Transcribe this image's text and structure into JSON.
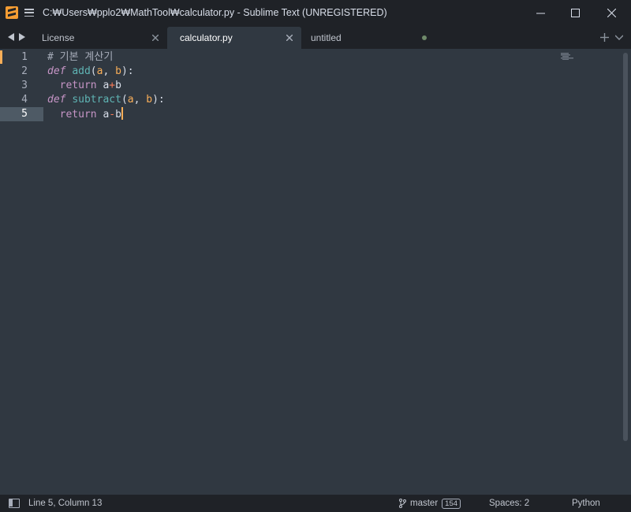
{
  "window": {
    "title": "C:₩Users₩pplo2₩MathTool₩calculator.py - Sublime Text (UNREGISTERED)",
    "app_icon": "sublime-logo-icon",
    "menu_icon": "hamburger-menu-icon",
    "controls": [
      "minimize-icon",
      "maximize-icon",
      "close-icon"
    ]
  },
  "tabs": [
    {
      "label": "License",
      "active": false,
      "dirty": false
    },
    {
      "label": "calculator.py",
      "active": true,
      "dirty": false
    },
    {
      "label": "untitled",
      "active": false,
      "dirty": true
    }
  ],
  "editor": {
    "line_numbers": [
      "1",
      "2",
      "3",
      "4",
      "5"
    ],
    "active_line": 5,
    "lines": [
      {
        "comment": "# 기본 계산기"
      },
      {
        "keyword": "def",
        "name": "add",
        "open": "(",
        "p1": "a",
        "sep": ", ",
        "p2": "b",
        "close": "):"
      },
      {
        "indent": "  ",
        "keyword": "return",
        "left": "a",
        "op": "+",
        "right": "b"
      },
      {
        "keyword": "def",
        "name": "subtract",
        "open": "(",
        "p1": "a",
        "sep": ", ",
        "p2": "b",
        "close": "):"
      },
      {
        "indent": "  ",
        "keyword": "return",
        "left": "a",
        "op": "-",
        "right": "b"
      }
    ]
  },
  "status": {
    "cursor_position": "Line 5, Column 13",
    "branch": "master",
    "branch_count": "154",
    "indentation": "Spaces: 2",
    "syntax": "Python"
  },
  "colors": {
    "background": "#303841",
    "chrome": "#1f2227",
    "accent": "#f9ae58",
    "keyword": "#c695c6",
    "function": "#5fb4b4"
  }
}
